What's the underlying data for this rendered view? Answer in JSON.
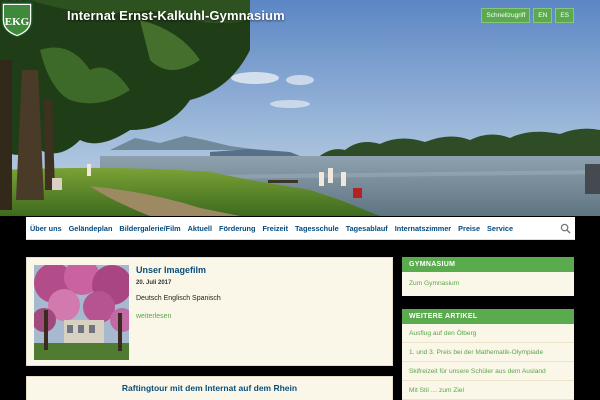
{
  "site": {
    "title": "Internat Ernst-Kalkuhl-Gymnasium",
    "crest_letters": "EKG"
  },
  "top_links": [
    {
      "label": "Schnellzugriff"
    },
    {
      "label": "EN"
    },
    {
      "label": "ES"
    }
  ],
  "nav": {
    "items": [
      {
        "label": "Über uns"
      },
      {
        "label": "Geländeplan"
      },
      {
        "label": "Bildergalerie/Film"
      },
      {
        "label": "Aktuell"
      },
      {
        "label": "Förderung"
      },
      {
        "label": "Freizeit"
      },
      {
        "label": "Tagesschule"
      },
      {
        "label": "Tagesablauf"
      },
      {
        "label": "Internatszimmer"
      },
      {
        "label": "Preise"
      },
      {
        "label": "Service"
      }
    ],
    "search_icon": "search-icon"
  },
  "posts": [
    {
      "title": "Unser Imagefilm",
      "date": "20. Juli 2017",
      "body": "Deutsch Englisch Spanisch",
      "more": "weiterlesen"
    },
    {
      "title": "Raftingtour mit dem Internat auf dem Rhein"
    }
  ],
  "sidebar": {
    "gymnasium": {
      "heading": "GYMNASIUM",
      "links": [
        {
          "label": "Zum Gymnasium"
        }
      ]
    },
    "articles": {
      "heading": "WEITERE ARTIKEL",
      "links": [
        {
          "label": "Ausflug auf den Ölberg"
        },
        {
          "label": "1. und 3. Preis bei der Mathematik-Olympiade"
        },
        {
          "label": "Skifreizeit für unsere Schüler aus dem Ausland"
        },
        {
          "label": "Mit Stil … zum Ziel"
        }
      ]
    }
  },
  "colors": {
    "accent_green": "#5aaa4e",
    "link_blue": "#004a80",
    "card_bg": "#fbf7e8"
  }
}
